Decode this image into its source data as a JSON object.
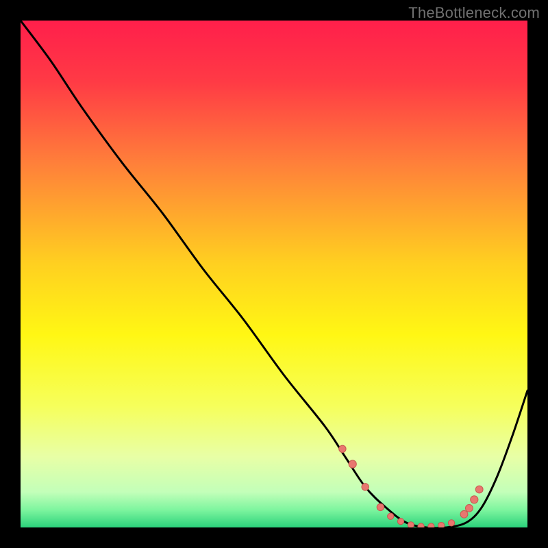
{
  "attribution": "TheBottleneck.com",
  "colors": {
    "frame": "#000000",
    "curve": "#000000",
    "marker_fill": "#e8776f",
    "marker_stroke": "#c9574f"
  },
  "chart_data": {
    "type": "line",
    "title": "",
    "xlabel": "",
    "ylabel": "",
    "xlim": [
      0,
      100
    ],
    "ylim": [
      0,
      100
    ],
    "grid": false,
    "legend": false,
    "gradient_stops": [
      {
        "pos": 0.0,
        "color": "#ff1f4b"
      },
      {
        "pos": 0.12,
        "color": "#ff3a45"
      },
      {
        "pos": 0.28,
        "color": "#ff7f3a"
      },
      {
        "pos": 0.48,
        "color": "#ffd020"
      },
      {
        "pos": 0.62,
        "color": "#fff714"
      },
      {
        "pos": 0.76,
        "color": "#f6ff5b"
      },
      {
        "pos": 0.86,
        "color": "#e8ffa6"
      },
      {
        "pos": 0.93,
        "color": "#c3ffb9"
      },
      {
        "pos": 0.965,
        "color": "#7ef59f"
      },
      {
        "pos": 1.0,
        "color": "#2bd27b"
      }
    ],
    "series": [
      {
        "name": "bottleneck-curve",
        "x": [
          0,
          6,
          12,
          20,
          28,
          36,
          44,
          52,
          60,
          64,
          68,
          72,
          76,
          80,
          84,
          88,
          91,
          94,
          97,
          100
        ],
        "y": [
          100,
          92,
          83,
          72,
          62,
          51,
          41,
          30,
          20,
          14,
          8,
          4,
          1,
          0,
          0,
          1,
          4,
          10,
          18,
          27
        ]
      }
    ],
    "markers": {
      "name": "highlight-dots",
      "x": [
        63.5,
        65.5,
        68,
        71,
        73,
        75,
        77,
        79,
        81,
        83,
        85,
        87.5,
        88.5,
        89.5,
        90.5
      ],
      "y": [
        15.5,
        12.5,
        8,
        4,
        2.2,
        1.2,
        0.5,
        0.2,
        0.2,
        0.4,
        0.9,
        2.6,
        3.8,
        5.5,
        7.5
      ],
      "r": [
        5.2,
        5.6,
        5.2,
        5.2,
        4.6,
        4.6,
        4.6,
        4.6,
        4.6,
        4.6,
        4.6,
        5.4,
        5.4,
        5.6,
        5.4
      ]
    }
  }
}
